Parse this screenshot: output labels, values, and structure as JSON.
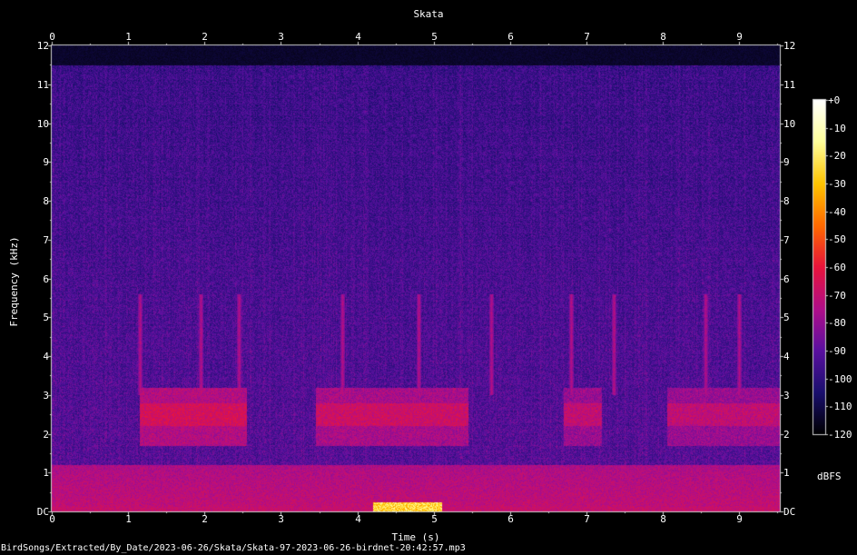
{
  "chart_data": {
    "type": "heatmap",
    "title": "Skata",
    "xlabel": "Time (s)",
    "ylabel": "Frequency (kHz)",
    "xlim": [
      0,
      9.53
    ],
    "ylim": [
      0,
      12
    ],
    "x_ticks": [
      "0",
      "1",
      "2",
      "3",
      "4",
      "5",
      "6",
      "7",
      "8",
      "9"
    ],
    "y_ticks": [
      "DC",
      "1",
      "2",
      "3",
      "4",
      "5",
      "6",
      "7",
      "8",
      "9",
      "10",
      "11",
      "12"
    ],
    "colorbar": {
      "label": "dBFS",
      "ticks": [
        "+0",
        "-10",
        "-20",
        "-30",
        "-40",
        "-50",
        "-60",
        "-70",
        "-80",
        "-90",
        "-100",
        "-110",
        "-120"
      ],
      "range": [
        -120,
        0
      ],
      "colors": [
        "#000000",
        "#1a0f6e",
        "#5a10a0",
        "#b00e8a",
        "#e8143c",
        "#ff6a00",
        "#ffc400",
        "#ffff9a",
        "#ffffff"
      ]
    },
    "signal_content_cutoff_khz": 11.5,
    "call_bursts": [
      {
        "start_s": 1.15,
        "end_s": 2.55,
        "freq_khz": [
          2.0,
          3.0
        ],
        "level_dbfs": -70
      },
      {
        "start_s": 3.45,
        "end_s": 5.45,
        "freq_khz": [
          2.0,
          3.0
        ],
        "level_dbfs": -72
      },
      {
        "start_s": 6.7,
        "end_s": 7.2,
        "freq_khz": [
          2.0,
          3.0
        ],
        "level_dbfs": -75
      },
      {
        "start_s": 8.05,
        "end_s": 9.53,
        "freq_khz": [
          2.0,
          3.0
        ],
        "level_dbfs": -75
      }
    ],
    "transients_s": [
      1.15,
      1.95,
      2.45,
      3.8,
      4.8,
      5.75,
      6.8,
      7.35,
      8.55,
      9.0
    ],
    "low_freq_band": {
      "freq_khz": [
        0,
        1.2
      ],
      "level_dbfs": -75
    },
    "dc_hotspot": {
      "start_s": 4.2,
      "end_s": 5.1,
      "level_dbfs": -25
    }
  },
  "footer": "BirdSongs/Extracted/By_Date/2023-06-26/Skata/Skata-97-2023-06-26-birdnet-20:42:57.mp3"
}
